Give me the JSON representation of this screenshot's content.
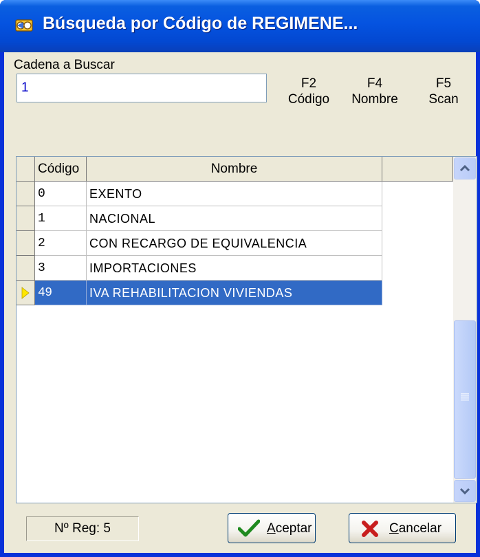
{
  "window": {
    "title": "Búsqueda por Código de REGIMENE..."
  },
  "search": {
    "label": "Cadena a Buscar",
    "value": "1"
  },
  "function_keys": [
    {
      "key": "F2",
      "label": "Código"
    },
    {
      "key": "F4",
      "label": "Nombre"
    },
    {
      "key": "F5",
      "label": "Scan"
    }
  ],
  "grid": {
    "columns": [
      "Código",
      "Nombre"
    ],
    "rows": [
      {
        "codigo": "0",
        "nombre": "EXENTO"
      },
      {
        "codigo": "1",
        "nombre": "NACIONAL"
      },
      {
        "codigo": "2",
        "nombre": "CON RECARGO DE EQUIVALENCIA"
      },
      {
        "codigo": "3",
        "nombre": "IMPORTACIONES"
      },
      {
        "codigo": "49",
        "nombre": "IVA REHABILITACION VIVIENDAS"
      }
    ],
    "selected_row": 4
  },
  "status": {
    "record_count": "Nº Reg: 5"
  },
  "buttons": {
    "accept_prefix": "",
    "accept_mnemonic": "A",
    "accept_rest": "ceptar",
    "cancel_mnemonic": "C",
    "cancel_rest": "ancelar"
  },
  "colors": {
    "title_bar": "#0553e0",
    "selection": "#316ac5",
    "face": "#ece9d8",
    "accept_icon": "#1f8a1f",
    "cancel_icon": "#c81e1e"
  },
  "icons": {
    "window": "binoculars-icon",
    "accept": "checkmark-icon",
    "cancel": "x-icon",
    "scroll_up": "chevron-up-icon",
    "scroll_down": "chevron-down-icon",
    "row_indicator": "triangle-right-icon"
  }
}
